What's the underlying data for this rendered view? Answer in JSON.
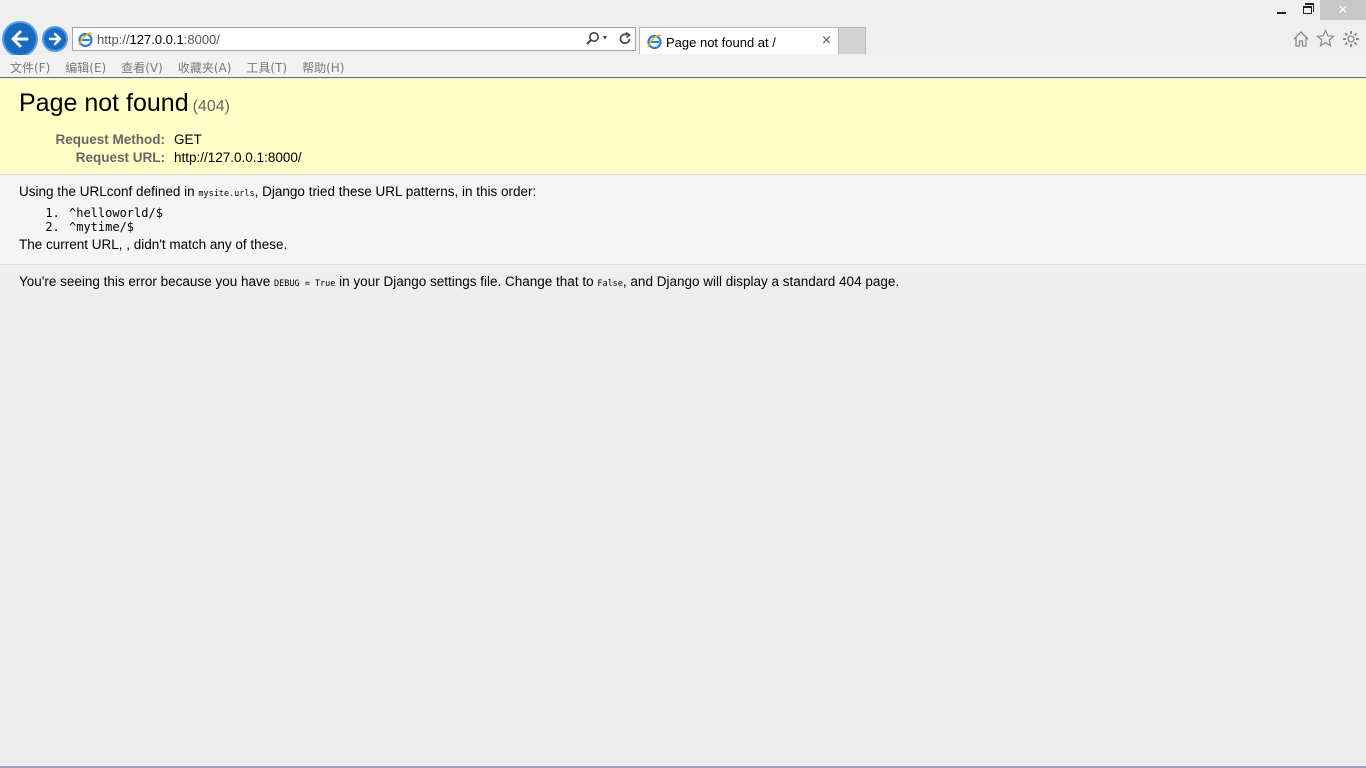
{
  "browser": {
    "url_prefix": "http://",
    "url_host": "127.0.0.1",
    "url_rest": ":8000/",
    "tab_title": "Page not found at /",
    "tab_close": "×",
    "search_dropdown": "▾",
    "window_close": "✕"
  },
  "menu": [
    "文件(F)",
    "编辑(E)",
    "查看(V)",
    "收藏夹(A)",
    "工具(T)",
    "帮助(H)"
  ],
  "summary": {
    "title": "Page not found",
    "code": "(404)",
    "method_label": "Request Method:",
    "method_value": "GET",
    "url_label": "Request URL:",
    "url_value": "http://127.0.0.1:8000/"
  },
  "info": {
    "intro_before": "Using the URLconf defined in ",
    "urlconf": "mysite.urls",
    "intro_after": ", Django tried these URL patterns, in this order:",
    "patterns": [
      "^helloworld/$",
      "^mytime/$"
    ],
    "current": "The current URL, , didn't match any of these."
  },
  "explanation": {
    "part1": "You're seeing this error because you have ",
    "debug_code": "DEBUG = True",
    "part2": " in your Django settings file. Change that to ",
    "false_code": "False",
    "part3": ", and Django will display a standard 404 page."
  },
  "colors": {
    "summary_bg": "#ffffc8",
    "nav_button": "#1a6bc0"
  }
}
